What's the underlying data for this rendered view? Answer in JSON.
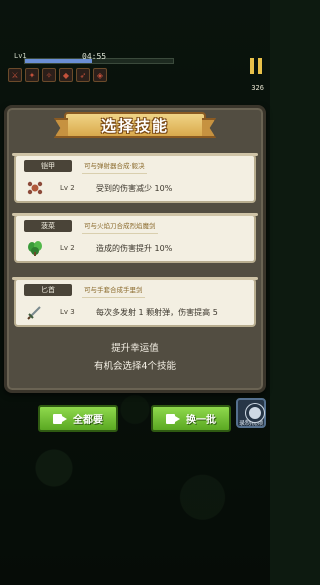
{
  "hud": {
    "level": "Lv1",
    "timer": "04:55",
    "exp_fraction": 0.45,
    "gold": "326",
    "slot_icons": [
      "sword-icon",
      "fire-icon",
      "blade-icon",
      "shield-icon",
      "arrow-icon",
      "gem-icon"
    ]
  },
  "panel": {
    "title": "选择技能",
    "cards": [
      {
        "name": "铠甲",
        "hint": "可与弹射器合成·毅决",
        "icon": "armor-icon",
        "level": "Lv 2",
        "description": "受到的伤害减少 10%"
      },
      {
        "name": "菠菜",
        "hint": "可与火焰刀合成烈焰魔剑",
        "icon": "spinach-icon",
        "level": "Lv 2",
        "description": "造成的伤害提升 10%"
      },
      {
        "name": "匕首",
        "hint": "可与手套合成手里剑",
        "icon": "dagger-icon",
        "level": "Lv 3",
        "description": "每次多发射 1 颗射弹，伤害提高 5"
      }
    ],
    "luck_line1": "提升幸运值",
    "luck_line2": "有机会选择4个技能"
  },
  "buttons": {
    "take_all": "全都要",
    "swap": "换一批"
  },
  "side": {
    "record_label": "录制视频"
  }
}
